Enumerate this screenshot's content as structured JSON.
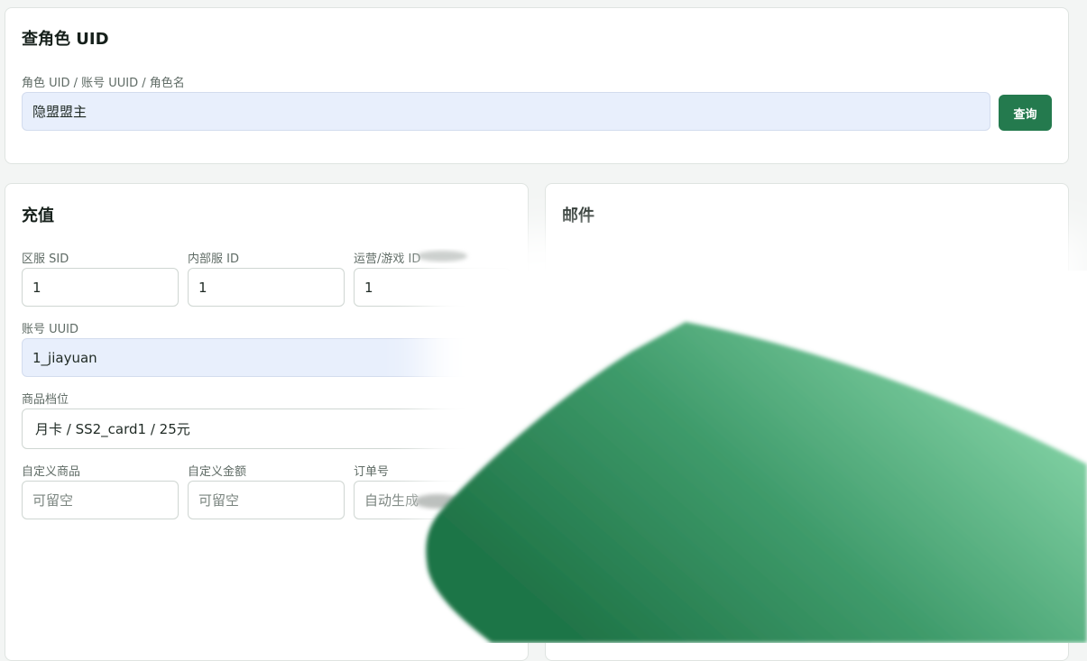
{
  "query": {
    "title": "查角色 UID",
    "label": "角色 UID / 账号 UUID / 角色名",
    "value": "隐盟盟主",
    "button": "查询"
  },
  "recharge": {
    "title": "充值",
    "sid_label": "区服 SID",
    "sid_value": "1",
    "internal_label": "内部服 ID",
    "internal_value": "1",
    "op_label": "运营/游戏 ID",
    "op_value": "1",
    "uuid_label": "账号 UUID",
    "uuid_value": "1_jiayuan",
    "product_label": "商品档位",
    "product_value": "月卡 / SS2_card1 / 25元",
    "custom_product_label": "自定义商品",
    "custom_product_placeholder": "可留空",
    "custom_amount_label": "自定义金额",
    "custom_amount_placeholder": "可留空",
    "order_label": "订单号",
    "order_placeholder": "自动生成"
  },
  "mail": {
    "title": "邮件"
  },
  "colors": {
    "accent": "#247a4e",
    "filled_input": "#e8effc",
    "overlay_green_light": "#86d6a8",
    "overlay_green_dark": "#1f7447"
  }
}
